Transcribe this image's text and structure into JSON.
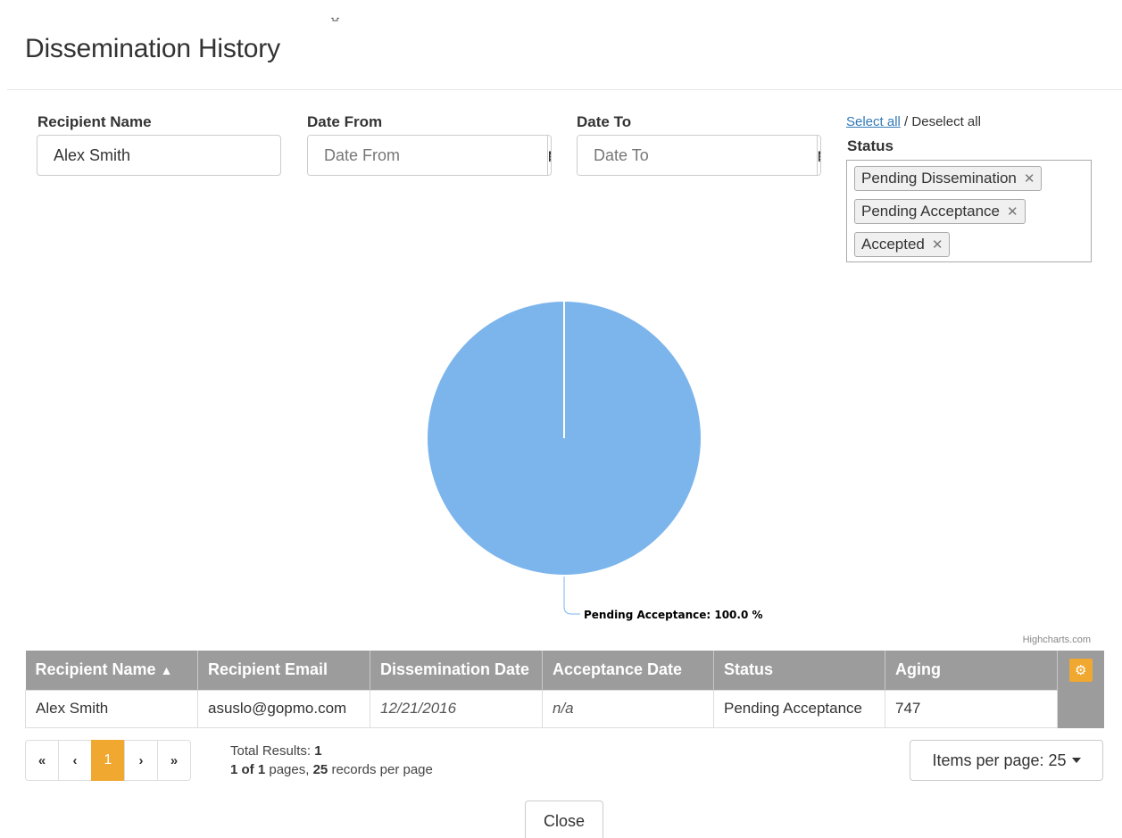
{
  "page": {
    "title": "Dissemination History"
  },
  "filters": {
    "recipient_name_label": "Recipient Name",
    "recipient_name_value": "Alex Smith",
    "date_from_label": "Date From",
    "date_from_placeholder": "Date From",
    "date_to_label": "Date To",
    "date_to_placeholder": "Date To",
    "select_all": "Select all",
    "separator": "/",
    "deselect_all": "Deselect all",
    "status_label": "Status",
    "status_tags": [
      "Pending Dissemination",
      "Pending Acceptance",
      "Accepted"
    ],
    "remove_symbol": "✕"
  },
  "chart_data": {
    "type": "pie",
    "slices": [
      {
        "label": "Pending Acceptance",
        "value": 100.0,
        "color": "#7cb5ec"
      }
    ],
    "data_label": "Pending Acceptance: 100.0 %",
    "credits": "Highcharts.com"
  },
  "table": {
    "columns": [
      "Recipient Name",
      "Recipient Email",
      "Dissemination Date",
      "Acceptance Date",
      "Status",
      "Aging"
    ],
    "sort_indicator": "ascending",
    "rows": [
      {
        "recipient_name": "Alex Smith",
        "recipient_email": "asuslo@gopmo.com",
        "dissemination_date": "12/21/2016",
        "acceptance_date": "n/a",
        "status": "Pending Acceptance",
        "aging": "747"
      }
    ]
  },
  "pagination": {
    "first": "«",
    "prev": "‹",
    "current_page": "1",
    "next": "›",
    "last": "»",
    "total_results_label": "Total Results:",
    "total_results": "1",
    "pages_current": "1",
    "pages_of": "of",
    "pages_total": "1",
    "pages_text": "pages,",
    "records_per_page": "25",
    "records_text": "records per page"
  },
  "items_per_page": {
    "label": "Items per page: 25"
  },
  "footer": {
    "close_label": "Close"
  },
  "colors": {
    "accent": "#f0a830",
    "header_grey": "#9c9c9c",
    "pie_blue": "#7cb5ec",
    "link_blue": "#337ab7"
  }
}
